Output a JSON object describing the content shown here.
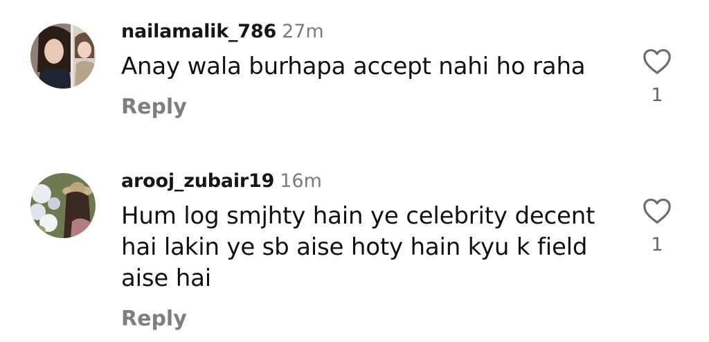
{
  "comments": [
    {
      "username": "nailamalik_786",
      "time": "27m",
      "text": "Anay wala burhapa accept nahi ho raha",
      "reply_label": "Reply",
      "like_count": "1",
      "like_icon": "heart-outline-icon"
    },
    {
      "username": "arooj_zubair19",
      "time": "16m",
      "text": "Hum log smjhty hain ye celebrity decent hai lakin ye sb aise hoty hain kyu k field aise hai",
      "reply_label": "Reply",
      "like_count": "1",
      "like_icon": "heart-outline-icon"
    }
  ]
}
